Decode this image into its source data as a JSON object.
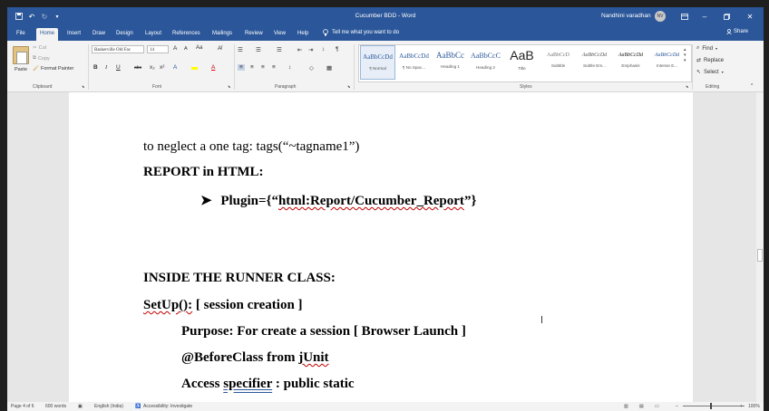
{
  "title_bar": {
    "doc_title": "Cucumber BDD  -  Word",
    "user_name": "Nandhini varadhan",
    "user_initials": "NV",
    "qa_icons": [
      "save-icon",
      "undo-icon",
      "redo-icon",
      "customize-icon"
    ]
  },
  "tabs": [
    "File",
    "Home",
    "Insert",
    "Draw",
    "Design",
    "Layout",
    "References",
    "Mailings",
    "Review",
    "View",
    "Help"
  ],
  "active_tab": "Home",
  "tell_me": "Tell me what you want to do",
  "share": "Share",
  "ribbon": {
    "clipboard": {
      "paste": "Paste",
      "cut": "Cut",
      "copy": "Copy",
      "format_painter": "Format Painter",
      "label": "Clipboard"
    },
    "font": {
      "font_name": "Baskerville Old Fac",
      "font_size": "14",
      "bold": "B",
      "italic": "I",
      "underline": "U",
      "strike": "abc",
      "subscript": "x₂",
      "superscript": "x²",
      "grow": "A",
      "shrink": "A",
      "case": "Aa",
      "font_color": "A",
      "label": "Font"
    },
    "paragraph_label": "Paragraph",
    "styles": [
      {
        "preview": "AaBbCcDd",
        "name": "¶ Normal"
      },
      {
        "preview": "AaBbCcDd",
        "name": "¶ No Spac..."
      },
      {
        "preview": "AaBbCc",
        "name": "Heading 1"
      },
      {
        "preview": "AaBbCcC",
        "name": "Heading 2"
      },
      {
        "preview": "AaB",
        "name": "Title"
      },
      {
        "preview": "AaBbCcD",
        "name": "Subtitle"
      },
      {
        "preview": "AaBbCcDd",
        "name": "Subtle Em..."
      },
      {
        "preview": "AaBbCcDd",
        "name": "Emphasis"
      },
      {
        "preview": "AaBbCcDd",
        "name": "Intense E..."
      }
    ],
    "styles_label": "Styles",
    "editing": {
      "find": "Find",
      "replace": "Replace",
      "select": "Select",
      "label": "Editing"
    }
  },
  "document": {
    "line1": "to neglect a one tag: tags(“~tagname1”)",
    "line2": "REPORT in HTML:",
    "line3_bullet": "➤",
    "line3_a": "Plugin={“",
    "line3_b": "html:Report/Cucumber_Report",
    "line3_c": "”}",
    "line4": "INSIDE THE RUNNER CLASS:",
    "line5_a": "SetUp():",
    "line5_b": " [ session creation ]",
    "line6": "Purpose: For create a session [ Browser Launch ]",
    "line7_a": "@BeforeClass from ",
    "line7_b": "jUnit",
    "line8_a": "Access ",
    "line8_b": "specifier",
    "line8_c": " : public static"
  },
  "status_bar": {
    "page": "Page 4 of 6",
    "words": "600 words",
    "language": "English (India)",
    "accessibility": "Accessibility: Investigate",
    "zoom": "100%"
  }
}
